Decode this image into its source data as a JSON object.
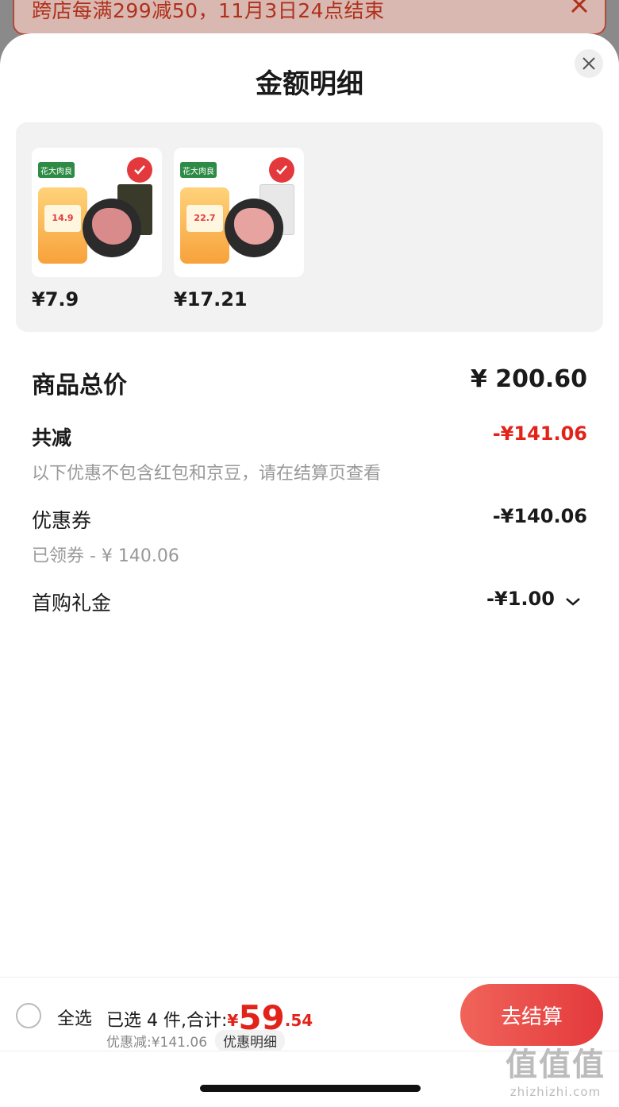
{
  "banner": {
    "text": "跨店每满299减50，11月3日24点结束"
  },
  "sheet": {
    "title": "金额明细"
  },
  "products": [
    {
      "price": "¥7.9",
      "brand": "花大肉良",
      "promo_price": "14.9"
    },
    {
      "price": "¥17.21",
      "brand": "花大肉良",
      "promo_price": "22.7"
    }
  ],
  "summary": {
    "total_label": "商品总价",
    "total_value": "¥ 200.60",
    "reduction_label": "共减",
    "reduction_value": "-¥141.06",
    "reduction_note": "以下优惠不包含红包和京豆，请在结算页查看",
    "coupon_label": "优惠券",
    "coupon_value": "-¥140.06",
    "coupon_note": "已领券 - ¥ 140.06",
    "gift_label": "首购礼金",
    "gift_value": "-¥1.00"
  },
  "bottom_bar": {
    "select_all": "全选",
    "selected_text": "已选 4 件,合计:",
    "currency": "¥",
    "amount_int": "59",
    "amount_dec": ".54",
    "discount_text": "优惠减:¥141.06",
    "detail_link": "优惠明细",
    "checkout": "去结算"
  },
  "watermark": {
    "top": "值值值",
    "bottom": "zhizhizhi.com"
  },
  "colors": {
    "accent_red": "#e2231a",
    "button_red": "#e4393c"
  }
}
